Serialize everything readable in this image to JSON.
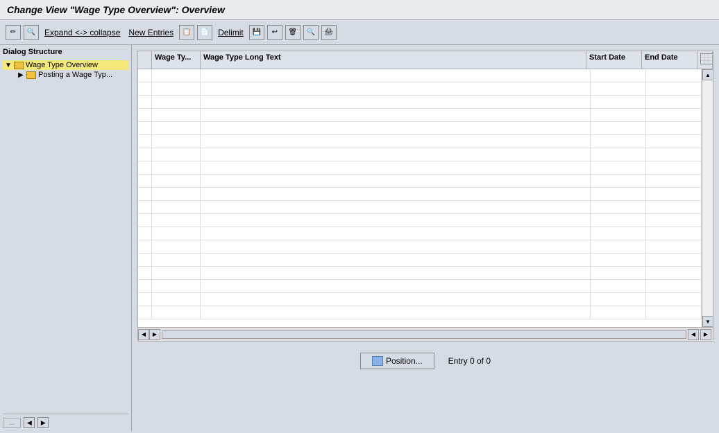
{
  "title": "Change View \"Wage Type Overview\": Overview",
  "toolbar": {
    "expand_collapse_label": "Expand <-> collapse",
    "new_entries_label": "New Entries",
    "delimit_label": "Delimit"
  },
  "sidebar": {
    "title": "Dialog Structure",
    "items": [
      {
        "label": "Wage Type Overview",
        "level": 1,
        "selected": true,
        "expanded": true
      },
      {
        "label": "Posting a Wage Typ...",
        "level": 2,
        "selected": false,
        "expanded": false
      }
    ],
    "scroll_placeholder": "..."
  },
  "table": {
    "columns": [
      {
        "label": "",
        "key": "select"
      },
      {
        "label": "Wage Ty...",
        "key": "wage_type"
      },
      {
        "label": "Wage Type Long Text",
        "key": "long_text"
      },
      {
        "label": "Start Date",
        "key": "start_date"
      },
      {
        "label": "End Date",
        "key": "end_date"
      }
    ],
    "rows": []
  },
  "footer": {
    "position_button_label": "Position...",
    "entry_count_label": "Entry 0 of 0"
  }
}
